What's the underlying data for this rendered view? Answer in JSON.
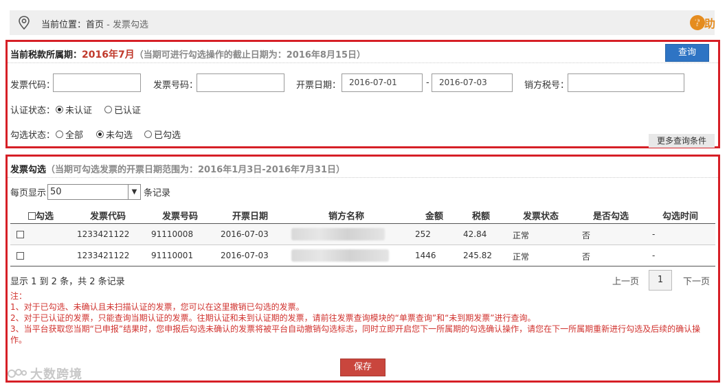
{
  "breadcrumb": {
    "prefix": "当前位置：",
    "home": "首页",
    "separator": " - ",
    "current": "发票勾选"
  },
  "help": {
    "icon": "question-icon",
    "label": "帮助",
    "color": "#e58c1f"
  },
  "tax_period": {
    "label": "当前税款所属期：",
    "value": "2016年7月",
    "note": "（当期可进行勾选操作的截止日期为：2016年8月15日）",
    "query_button": "查询"
  },
  "filters": {
    "invoice_code_label": "发票代码：",
    "invoice_code_value": "",
    "invoice_number_label": "发票号码：",
    "invoice_number_value": "",
    "date_label": "开票日期：",
    "date_from": "2016-07-01",
    "date_sep": "-",
    "date_to": "2016-07-03",
    "seller_tax_label": "销方税号：",
    "seller_tax_value": "",
    "auth_label": "认证状态：",
    "auth_options": [
      "未认证",
      "已认证"
    ],
    "auth_selected": "未认证",
    "select_label": "勾选状态：",
    "select_options": [
      "全部",
      "未勾选",
      "已勾选"
    ],
    "select_selected": "未勾选",
    "more_button": "更多查询条件"
  },
  "invoice_section": {
    "title": "发票勾选",
    "note": "（当期可勾选发票的开票日期范围为：2016年1月3日-2016年7月31日）",
    "per_page_prefix": "每页显示",
    "per_page_value": "50",
    "per_page_suffix": "条记录",
    "columns": [
      "勾选",
      "发票代码",
      "发票号码",
      "开票日期",
      "销方名称",
      "金额",
      "税额",
      "发票状态",
      "是否勾选",
      "勾选时间"
    ],
    "rows": [
      {
        "code": "1233421122",
        "number": "91110008",
        "date": "2016-07-03",
        "amount": "252",
        "tax": "42.84",
        "status": "正常",
        "selected": "否",
        "time": "-"
      },
      {
        "code": "1233421122",
        "number": "91110001",
        "date": "2016-07-03",
        "amount": "1446",
        "tax": "245.82",
        "status": "正常",
        "selected": "否",
        "time": "-"
      }
    ],
    "record_count": "显示 1 到 2 条，共 2 条记录",
    "pager": {
      "prev": "上一页",
      "page": "1",
      "next": "下一页"
    },
    "notes_title": "注：",
    "notes": [
      "1、对于已勾选、未确认且未扫描认证的发票，您可以在这里撤销已勾选的发票。",
      "2、对于已认证的发票，只能查询当期认证的发票。往期认证和未到认证期的发票，请前往发票查询模块的“单票查询”和“未到期发票”进行查询。",
      "3、当平台获取您当期“已申报”结果时，您申报后勾选未确认的发票将被平台自动撤销勾选标志，同时立即开启您下一所属期的勾选确认操作，请您在下一所属期重新进行勾选及后续的确认操作。"
    ],
    "save_button": "保存"
  },
  "watermark": "大数跨境"
}
